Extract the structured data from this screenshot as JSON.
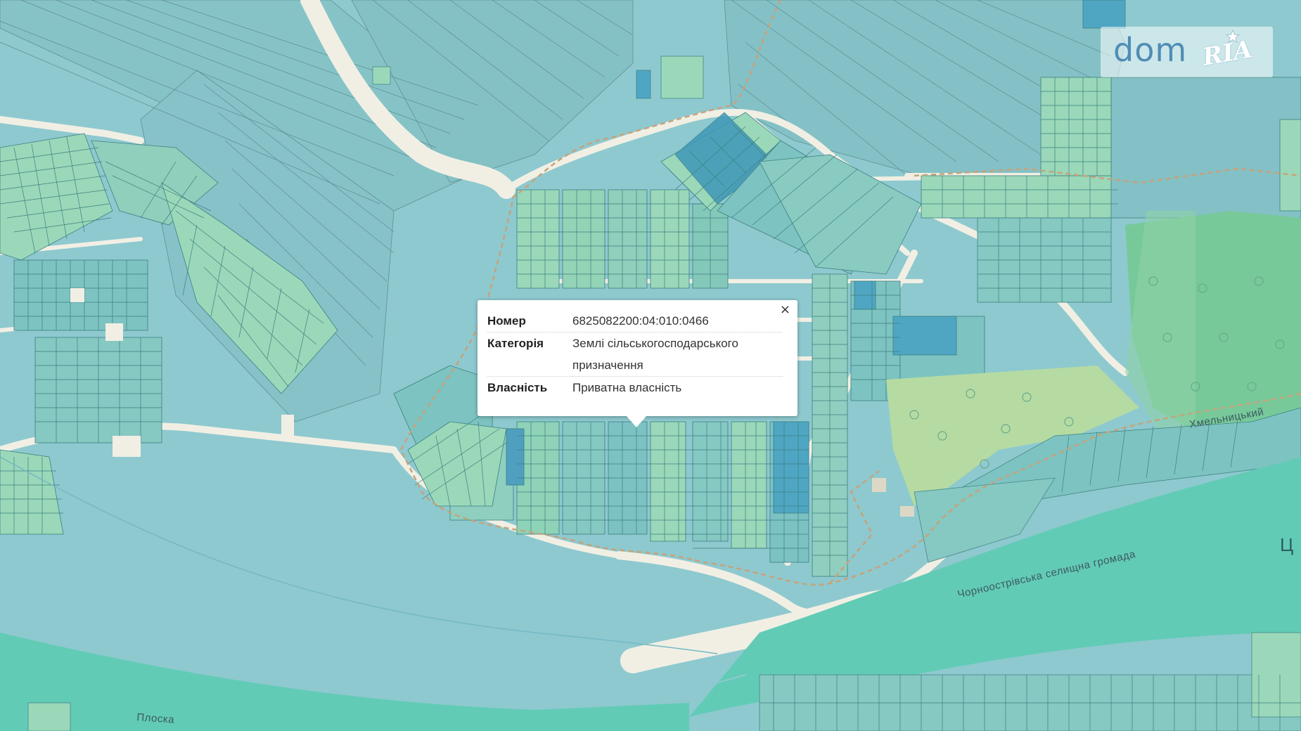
{
  "popup": {
    "rows": [
      {
        "key": "Номер",
        "value": "6825082200:04:010:0466"
      },
      {
        "key": "Категорія",
        "value": "Землі сільськогосподарського призначення"
      },
      {
        "key": "Власність",
        "value": "Приватна власність"
      }
    ],
    "close_label": "×"
  },
  "logo": {
    "part1": "dom",
    "part2": "RIA"
  },
  "map_labels": {
    "street_khmelnytskyi": "Хмельницький",
    "community": "Чорноострівська селищна громада",
    "river": "Плоска",
    "edge_text": "Ц"
  },
  "colors": {
    "field": "#8ec9cf",
    "parcel_green": "#9ad8b9",
    "parcel_teal": "#7dc3c1",
    "parcel_blue": "#5aaac6",
    "road": "#f1efe4",
    "forest": "#b5dba3",
    "forest_dark": "#77c99a",
    "river": "#62cbb6",
    "boundary": "#c7a27a"
  }
}
